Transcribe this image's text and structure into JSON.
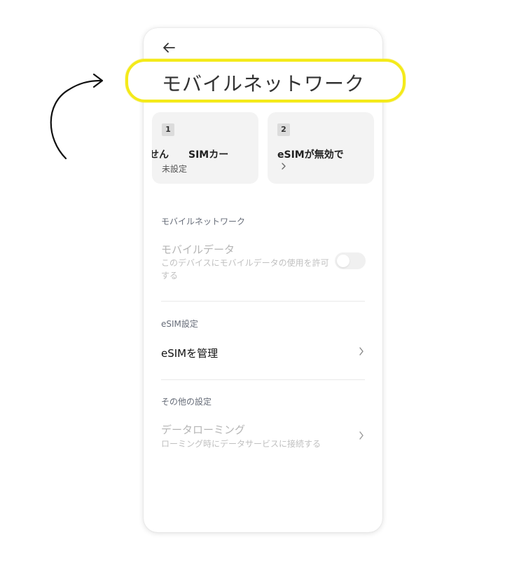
{
  "annotation": {
    "highlighted_title": "モバイルネットワーク"
  },
  "sim_cards": [
    {
      "slot": "1",
      "name": "せん　　SIMカー",
      "status": "未設定"
    },
    {
      "slot": "2",
      "name": "eSIMが無効で",
      "status": ""
    }
  ],
  "sections": {
    "mobile_network": {
      "label": "モバイルネットワーク",
      "mobile_data": {
        "title": "モバイルデータ",
        "subtitle": "このデバイスにモバイルデータの使用を許可する",
        "enabled": false
      }
    },
    "esim": {
      "label": "eSIM設定",
      "manage": "eSIMを管理"
    },
    "other": {
      "label": "その他の設定",
      "roaming": {
        "title": "データローミング",
        "subtitle": "ローミング時にデータサービスに接続する"
      }
    }
  },
  "colors": {
    "highlight": "#f4ea1a",
    "card_bg": "#f3f3f3"
  }
}
